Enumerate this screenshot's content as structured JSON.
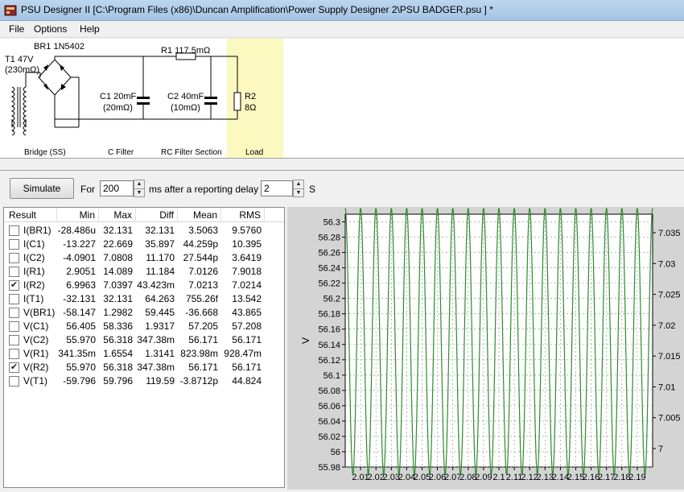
{
  "window": {
    "title": "PSU Designer II  [C:\\Program Files (x86)\\Duncan Amplification\\Power Supply Designer 2\\PSU BADGER.psu ] *",
    "accent": "#b0cde8"
  },
  "menu": [
    "File",
    "Options",
    "Help"
  ],
  "schematic": {
    "bridge_label": "BR1 1N5402",
    "transformer_label": "T1 47V",
    "transformer_res": "(230mΩ)",
    "r1_label": "R1 117.5mΩ",
    "c1_label": "C1 20mF",
    "c1_res": "(20mΩ)",
    "c2_label": "C2 40mF",
    "c2_res": "(10mΩ)",
    "r2_label": "R2",
    "r2_value": "8Ω",
    "sections": [
      "Bridge (SS)",
      "C Filter",
      "RC Filter Section",
      "Load"
    ],
    "load_highlight": "#fbf8c0"
  },
  "controls": {
    "simulate_label": "Simulate",
    "for_label": "For",
    "duration_value": "200",
    "ms_label": "ms  after a reporting delay of",
    "delay_value": "2",
    "s_label": "S"
  },
  "results": {
    "columns": [
      "Result",
      "Min",
      "Max",
      "Diff",
      "Mean",
      "RMS"
    ],
    "rows": [
      {
        "name": "I(BR1)",
        "checked": false,
        "min": "-28.486u",
        "max": "32.131",
        "diff": "32.131",
        "mean": "3.5063",
        "rms": "9.5760"
      },
      {
        "name": "I(C1)",
        "checked": false,
        "min": "-13.227",
        "max": "22.669",
        "diff": "35.897",
        "mean": "44.259p",
        "rms": "10.395"
      },
      {
        "name": "I(C2)",
        "checked": false,
        "min": "-4.0901",
        "max": "7.0808",
        "diff": "11.170",
        "mean": "27.544p",
        "rms": "3.6419"
      },
      {
        "name": "I(R1)",
        "checked": false,
        "min": "2.9051",
        "max": "14.089",
        "diff": "11.184",
        "mean": "7.0126",
        "rms": "7.9018"
      },
      {
        "name": "I(R2)",
        "checked": true,
        "min": "6.9963",
        "max": "7.0397",
        "diff": "43.423m",
        "mean": "7.0213",
        "rms": "7.0214"
      },
      {
        "name": "I(T1)",
        "checked": false,
        "min": "-32.131",
        "max": "32.131",
        "diff": "64.263",
        "mean": "755.26f",
        "rms": "13.542"
      },
      {
        "name": "V(BR1)",
        "checked": false,
        "min": "-58.147",
        "max": "1.2982",
        "diff": "59.445",
        "mean": "-36.668",
        "rms": "43.865"
      },
      {
        "name": "V(C1)",
        "checked": false,
        "min": "56.405",
        "max": "58.336",
        "diff": "1.9317",
        "mean": "57.205",
        "rms": "57.208"
      },
      {
        "name": "V(C2)",
        "checked": false,
        "min": "55.970",
        "max": "56.318",
        "diff": "347.38m",
        "mean": "56.171",
        "rms": "56.171"
      },
      {
        "name": "V(R1)",
        "checked": false,
        "min": "341.35m",
        "max": "1.6554",
        "diff": "1.3141",
        "mean": "823.98m",
        "rms": "928.47m"
      },
      {
        "name": "V(R2)",
        "checked": true,
        "min": "55.970",
        "max": "56.318",
        "diff": "347.38m",
        "mean": "56.171",
        "rms": "56.171"
      },
      {
        "name": "V(T1)",
        "checked": false,
        "min": "-59.796",
        "max": "59.796",
        "diff": "119.59",
        "mean": "-3.8712p",
        "rms": "44.824"
      }
    ]
  },
  "chart_data": {
    "type": "line",
    "ylabel": "V",
    "ylim": [
      55.98,
      56.31
    ],
    "y_ticks": [
      "56.3",
      "56.28",
      "56.26",
      "56.24",
      "56.22",
      "56.2",
      "56.18",
      "56.16",
      "56.14",
      "56.12",
      "56.1",
      "56.08",
      "56.06",
      "56.04",
      "56.02",
      "56",
      "55.98"
    ],
    "y2lim": [
      6.997,
      7.038
    ],
    "y2_ticks": [
      "7.035",
      "7.03",
      "7.025",
      "7.02",
      "7.015",
      "7.01",
      "7.005",
      "7"
    ],
    "xlim": [
      2.0,
      2.2
    ],
    "x_ticks": [
      "2.01",
      "2.02",
      "2.03",
      "2.04",
      "2.05",
      "2.06",
      "2.07",
      "2.08",
      "2.09",
      "2.1",
      "2.11",
      "2.12",
      "2.13",
      "2.14",
      "2.15",
      "2.16",
      "2.17",
      "2.18",
      "2.19"
    ],
    "series": [
      {
        "color": "#2e8b2e",
        "period": 0.01,
        "min": 55.97,
        "max": 56.318
      }
    ],
    "plot_bg": "#ffffff",
    "panel_bg": "#d4d4d4"
  }
}
